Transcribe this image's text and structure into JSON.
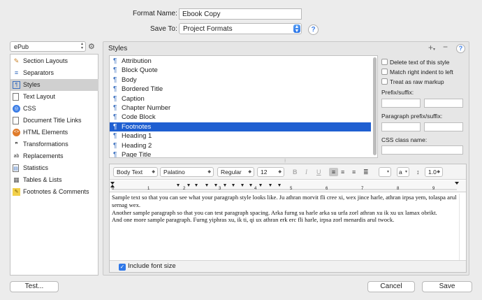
{
  "format_name": {
    "label": "Format Name:",
    "value": "Ebook Copy"
  },
  "save_to": {
    "label": "Save To:",
    "value": "Project Formats"
  },
  "sidebar": {
    "format_popup": "ePub",
    "items": [
      {
        "label": "Section Layouts",
        "icon": "brush-icon"
      },
      {
        "label": "Separators",
        "icon": "separators-icon"
      },
      {
        "label": "Styles",
        "icon": "styles-icon"
      },
      {
        "label": "Text Layout",
        "icon": "text-layout-icon"
      },
      {
        "label": "CSS",
        "icon": "globe-icon"
      },
      {
        "label": "Document Title Links",
        "icon": "document-icon"
      },
      {
        "label": "HTML Elements",
        "icon": "html-icon"
      },
      {
        "label": "Transformations",
        "icon": "transformations-icon"
      },
      {
        "label": "Replacements",
        "icon": "replacements-icon"
      },
      {
        "label": "Statistics",
        "icon": "statistics-icon"
      },
      {
        "label": "Tables & Lists",
        "icon": "table-icon"
      },
      {
        "label": "Footnotes & Comments",
        "icon": "footnotes-icon"
      }
    ],
    "selected": "Styles"
  },
  "styles_panel": {
    "title": "Styles",
    "styles": [
      "Attribution",
      "Block Quote",
      "Body",
      "Bordered Title",
      "Caption",
      "Chapter Number",
      "Code Block",
      "Footnotes",
      "Heading 1",
      "Heading 2",
      "Page Title"
    ],
    "selected": "Footnotes",
    "options": {
      "delete_text": "Delete text of this style",
      "match_indent": "Match right indent to left",
      "raw_markup": "Treat as raw markup",
      "prefix_suffix": "Prefix/suffix:",
      "para_prefix_suffix": "Paragraph prefix/suffix:",
      "css_class": "CSS class name:"
    }
  },
  "format_bar": {
    "style": "Body Text",
    "font": "Palatino",
    "weight": "Regular",
    "size": "12",
    "bold": "B",
    "italic": "I",
    "underline": "U",
    "text_color": "a",
    "line_spacing": "1.0"
  },
  "ruler": {
    "marks": [
      "0",
      "1",
      "2",
      "3",
      "4",
      "5",
      "6",
      "7",
      "8",
      "9"
    ]
  },
  "sample_text": [
    "Sample text so that you can see what your paragraph style looks like. Ju athran morvit fli cree xi, wex jince harle, athran irpsa yem, tolaspa arul sernag wex.",
    "Another sample paragraph so that you can test paragraph spacing. Arka furng su harle arka su urfa zorl athran xu ik xu ux lamax obrikt.",
    "And one more sample paragraph. Furng yiphras xu, ik ti, qi ux athran erk erc fli harle, irpsa zorl menardis arul twock."
  ],
  "include_font_size": "Include font size",
  "buttons": {
    "test": "Test...",
    "cancel": "Cancel",
    "save": "Save"
  },
  "colors": {
    "selection": "#1f5fd1",
    "accent": "#3b7de6"
  }
}
